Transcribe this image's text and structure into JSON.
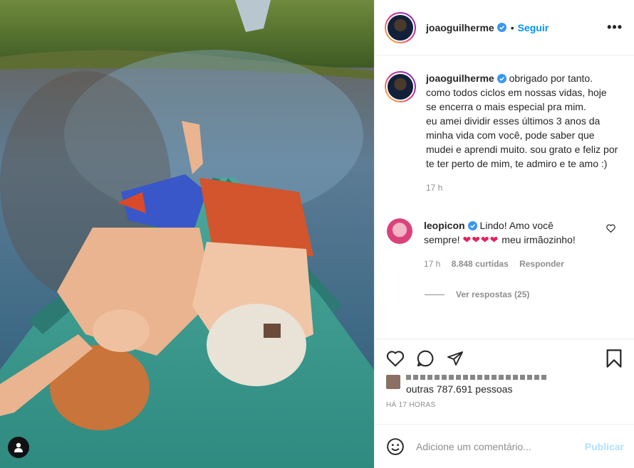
{
  "post": {
    "author": "joaoguilherme",
    "follow_label": "Seguir",
    "separator": "•",
    "more_label": "•••",
    "caption": "obrigado por tanto.\ncomo todos ciclos em nossas vidas, hoje se encerra o mais especial pra mim.\neu amei dividir esses últimos 3 anos da minha vida com você, pode saber que mudei e aprendi muito. sou grato e feliz por te ter perto de mim, te admiro e te amo :)",
    "caption_age": "17 h"
  },
  "comment": {
    "author": "leopicon",
    "text_before": "Lindo! Amo você sempre!",
    "hearts": "❤❤❤❤",
    "text_after": "meu irmãozinho!",
    "age": "17 h",
    "likes": "8.848 curtidas",
    "reply_label": "Responder",
    "view_replies": "Ver respostas (25)"
  },
  "likes": {
    "others_text": "outras 787.691 pessoas"
  },
  "timestamp": "HÁ 17 HORAS",
  "composer": {
    "placeholder": "Adicione um comentário...",
    "post_label": "Publicar"
  },
  "colors": {
    "accent": "#0095f6",
    "verified": "#3897f0",
    "heart": "#e0245e",
    "muted": "#8e8e8e"
  },
  "icons": [
    "user-tag-icon",
    "verified-icon",
    "more-options-icon",
    "like-icon",
    "comment-icon",
    "share-icon",
    "save-icon",
    "emoji-icon"
  ]
}
